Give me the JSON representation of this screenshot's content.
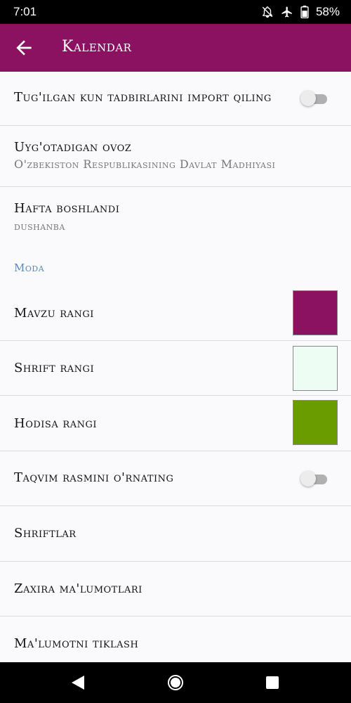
{
  "status_bar": {
    "time": "7:01",
    "battery": "58%",
    "icons": [
      "notifications-off-icon",
      "airplane-icon",
      "battery-icon"
    ]
  },
  "app_bar": {
    "title": "Kalendar",
    "back_icon": "arrow-left-icon",
    "background_color": "#8b1260"
  },
  "settings": {
    "import_birthdays": {
      "label": "Tug'ilgan kun tadbirlarini import qiling",
      "enabled": false
    },
    "ringtone": {
      "label": "Uyg'otadigan ovoz",
      "value": "O'zbekiston Respublikasining Davlat Madhiyasi"
    },
    "week_start": {
      "label": "Hafta boshlandi",
      "value": "dushanba"
    },
    "section_fashion": "Moda",
    "theme_color": {
      "label": "Mavzu rangi",
      "color": "#8b1260"
    },
    "font_color": {
      "label": "Shrift rangi",
      "color": "#eefdf3"
    },
    "event_color": {
      "label": "Hodisa rangi",
      "color": "#6a9c00"
    },
    "calendar_image": {
      "label": "Taqvim rasmini o'rnating",
      "enabled": false
    },
    "fonts": {
      "label": "Shriftlar"
    },
    "backup": {
      "label": "Zaxira ma'lumotlari"
    },
    "restore": {
      "label": "Ma'lumotni tiklash"
    }
  },
  "nav_bar": {
    "icons": [
      "back-triangle-icon",
      "home-circle-icon",
      "recents-square-icon"
    ]
  }
}
